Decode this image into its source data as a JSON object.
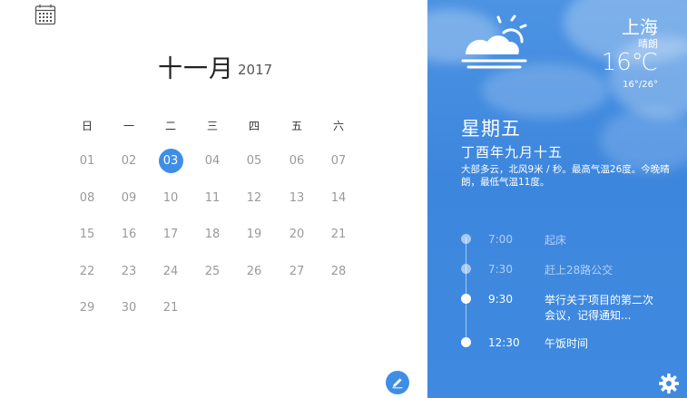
{
  "calendar": {
    "month": "十一月",
    "year": "2017",
    "weekdays": [
      "日",
      "一",
      "二",
      "三",
      "四",
      "五",
      "六"
    ],
    "weeks": [
      [
        "01",
        "02",
        "03",
        "04",
        "05",
        "06",
        "07"
      ],
      [
        "08",
        "09",
        "10",
        "11",
        "12",
        "13",
        "14"
      ],
      [
        "15",
        "16",
        "17",
        "18",
        "19",
        "20",
        "21"
      ],
      [
        "22",
        "23",
        "24",
        "25",
        "26",
        "27",
        "28"
      ],
      [
        "29",
        "30",
        "21"
      ]
    ],
    "selected_day": "03",
    "accent_color": "#3f8ee6"
  },
  "weather": {
    "city": "上海",
    "condition": "晴朗",
    "temperature": "16℃",
    "range": "16°/26°",
    "icon": "partly-sunny-icon",
    "weekday": "星期五",
    "lunar_date": "丁酉年九月十五",
    "description": "大部多云，北风9米 / 秒。最高气温26度。今晚晴朗，最低气温11度。"
  },
  "schedule": [
    {
      "time": "7:00",
      "text": "起床",
      "past": true
    },
    {
      "time": "7:30",
      "text": "赶上28路公交",
      "past": true
    },
    {
      "time": "9:30",
      "text": "举行关于项目的第二次会议，记得通知...",
      "past": false
    },
    {
      "time": "12:30",
      "text": "午饭时间",
      "past": false
    }
  ],
  "icons": {
    "calendar": "calendar-icon",
    "edit": "pencil-icon",
    "settings": "gear-icon"
  }
}
